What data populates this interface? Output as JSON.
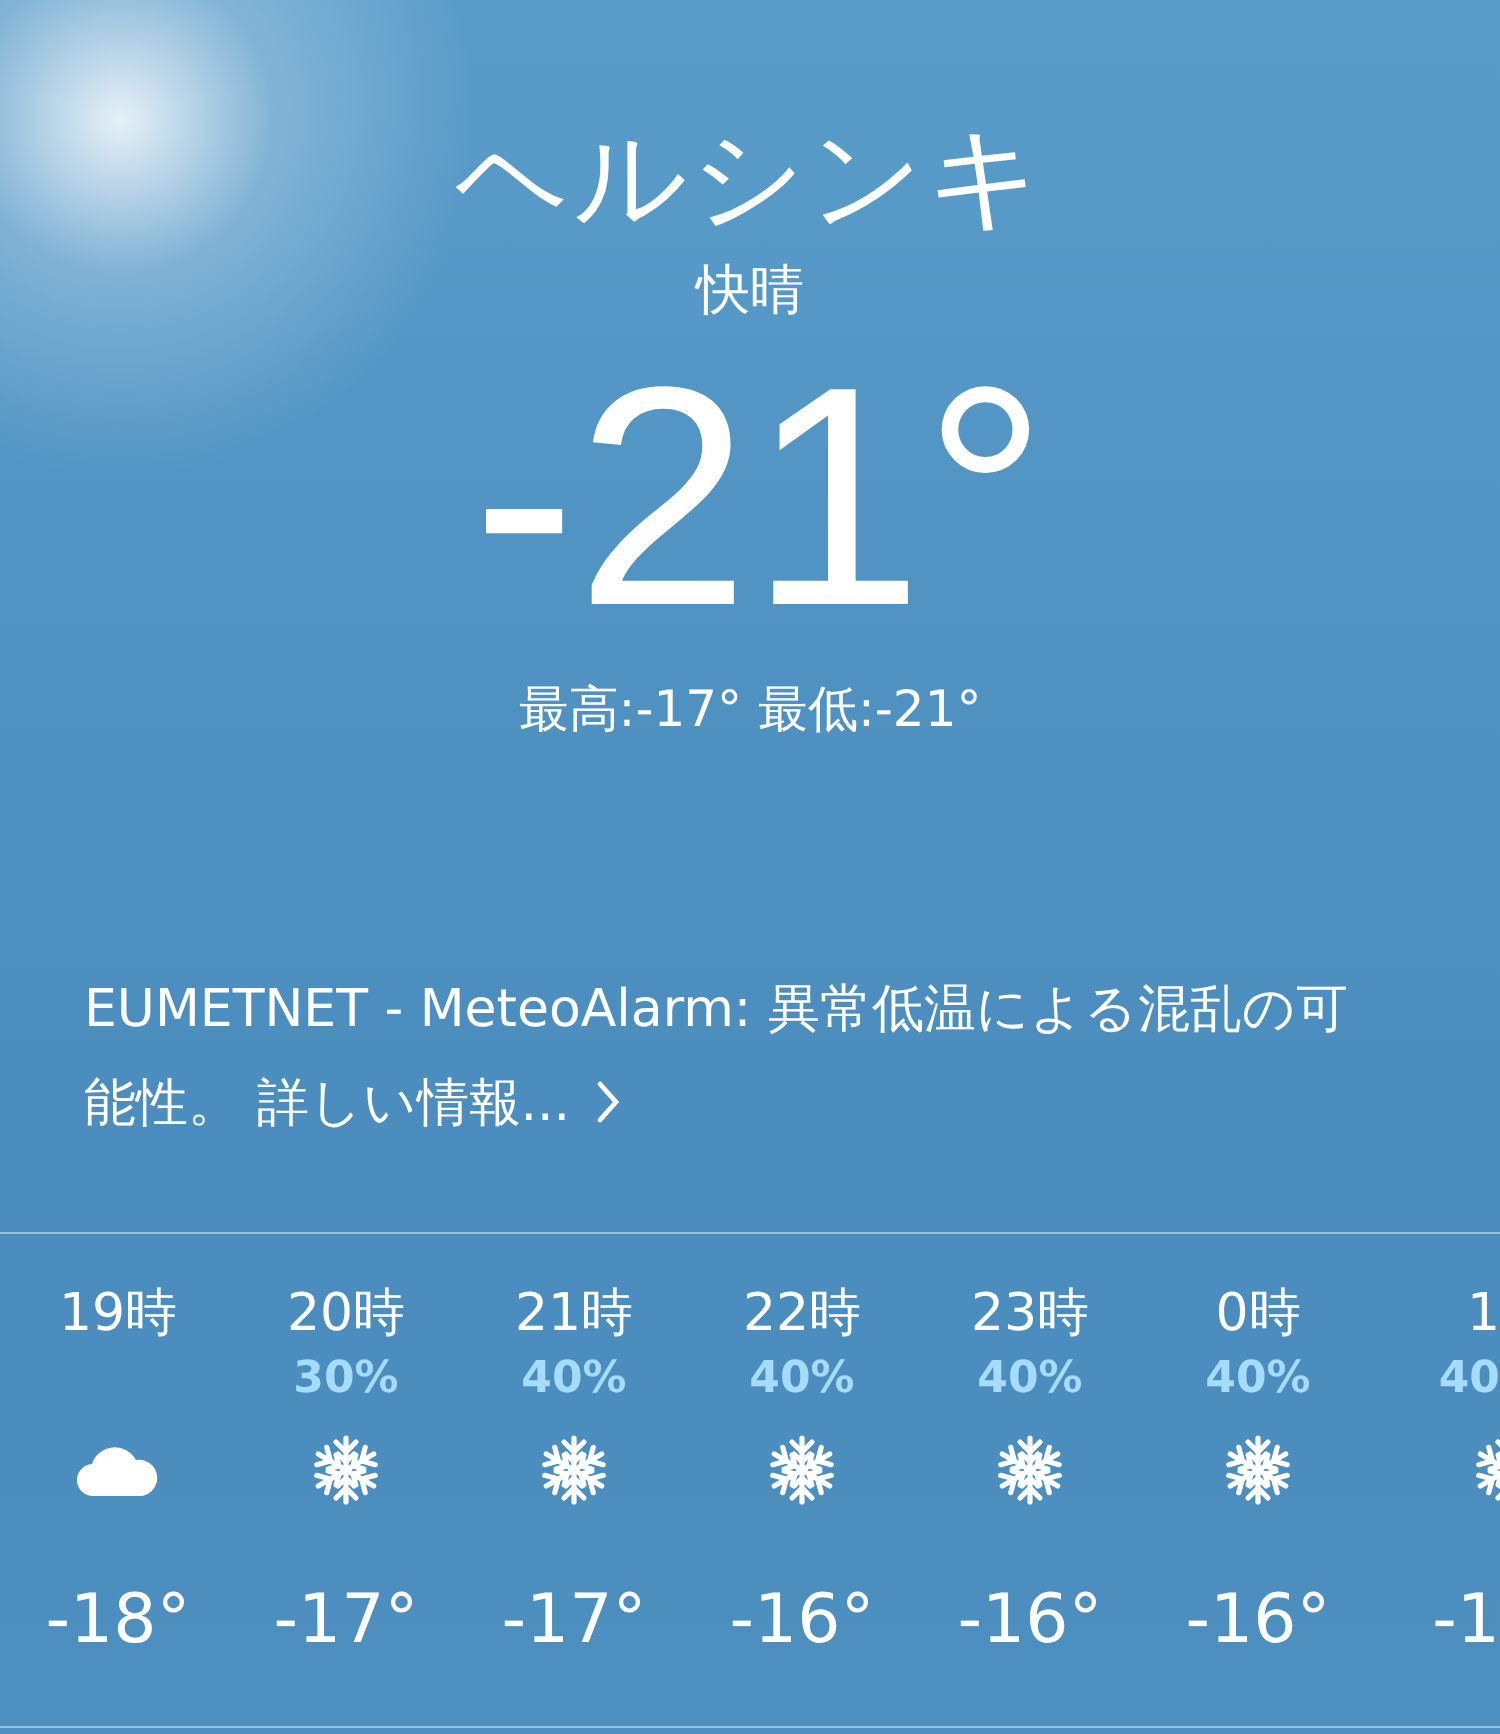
{
  "city": "ヘルシンキ",
  "condition": "快晴",
  "temperature": "-21°",
  "high_low": "最高:-17° 最低:-21°",
  "alert": {
    "text": "EUMETNET - MeteoAlarm: 異常低温による混乱の可能性。 詳しい情報..."
  },
  "hourly": [
    {
      "time": "19時",
      "kind": "cloud",
      "temp": "-18°"
    },
    {
      "time": "20時",
      "chance": "30%",
      "kind": "snow",
      "temp": "-17°"
    },
    {
      "time": "21時",
      "chance": "40%",
      "kind": "snow",
      "temp": "-17°"
    },
    {
      "time": "22時",
      "chance": "40%",
      "kind": "snow",
      "temp": "-16°"
    },
    {
      "time": "23時",
      "chance": "40%",
      "kind": "snow",
      "temp": "-16°"
    },
    {
      "time": "0時",
      "chance": "40%",
      "kind": "snow",
      "temp": "-16°"
    },
    {
      "time": "1",
      "chance": "40",
      "kind": "partial",
      "temp": "-1"
    }
  ]
}
